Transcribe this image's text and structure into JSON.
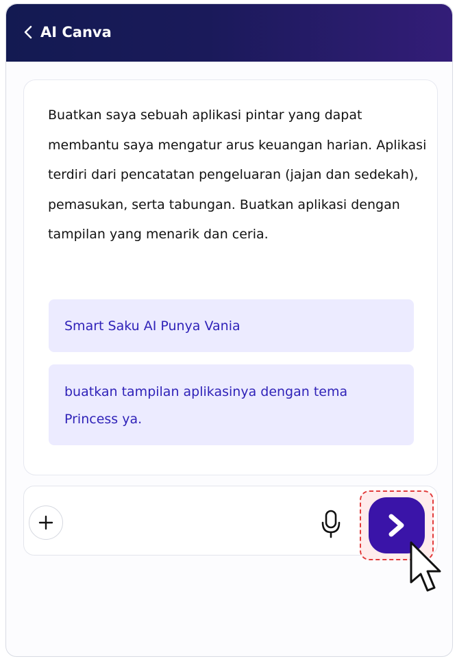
{
  "header": {
    "title": "AI Canva",
    "back_icon": "chevron-left-icon"
  },
  "prompt": {
    "text": "Buatkan saya sebuah aplikasi pintar yang dapat membantu saya mengatur arus keuangan harian. Aplikasi terdiri dari pencatatan pengeluaran (jajan dan sedekah), pemasukan, serta tabungan. Buatkan aplikasi dengan tampilan yang menarik dan ceria."
  },
  "suggestions": [
    {
      "label": "Smart Saku AI Punya Vania"
    },
    {
      "label": "buatkan tampilan aplikasinya dengan tema Princess ya."
    }
  ],
  "input_bar": {
    "value": "",
    "plus_icon": "plus-icon",
    "mic_icon": "microphone-icon",
    "send_icon": "send-arrow-icon"
  },
  "colors": {
    "header_start": "#131a52",
    "header_end": "#331d78",
    "send_button": "#3a14a8",
    "suggestion_bg": "#ecebff",
    "suggestion_text": "#2f22b8",
    "highlight_border": "#e23b3b"
  }
}
